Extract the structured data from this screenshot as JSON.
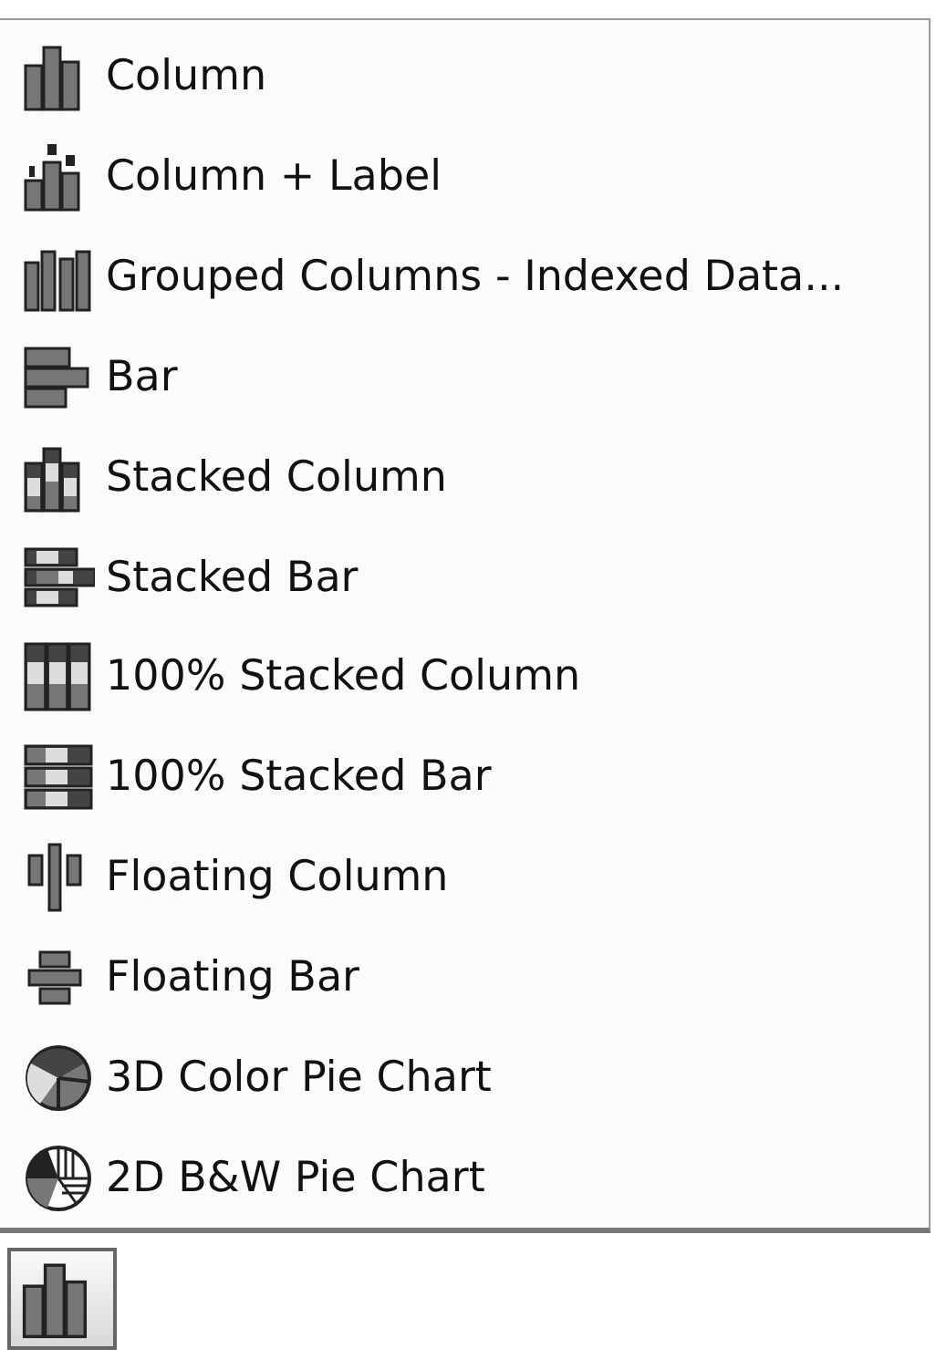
{
  "menu": {
    "items": [
      {
        "label": "Column",
        "kind": "column"
      },
      {
        "label": "Column + Label",
        "kind": "column-label"
      },
      {
        "label": "Grouped Columns - Indexed Data...",
        "kind": "grouped"
      },
      {
        "label": "Bar",
        "kind": "bar"
      },
      {
        "label": "Stacked Column",
        "kind": "stacked-column"
      },
      {
        "label": "Stacked Bar",
        "kind": "stacked-bar"
      },
      {
        "label": "100% Stacked Column",
        "kind": "full-stacked-column"
      },
      {
        "label": "100% Stacked Bar",
        "kind": "full-stacked-bar"
      },
      {
        "label": "Floating Column",
        "kind": "floating-column"
      },
      {
        "label": "Floating Bar",
        "kind": "floating-bar"
      },
      {
        "label": "3D Color Pie Chart",
        "kind": "pie-3d"
      },
      {
        "label": "2D B&W Pie Chart",
        "kind": "pie-bw"
      }
    ]
  },
  "chart_type_button": {
    "kind": "column"
  }
}
